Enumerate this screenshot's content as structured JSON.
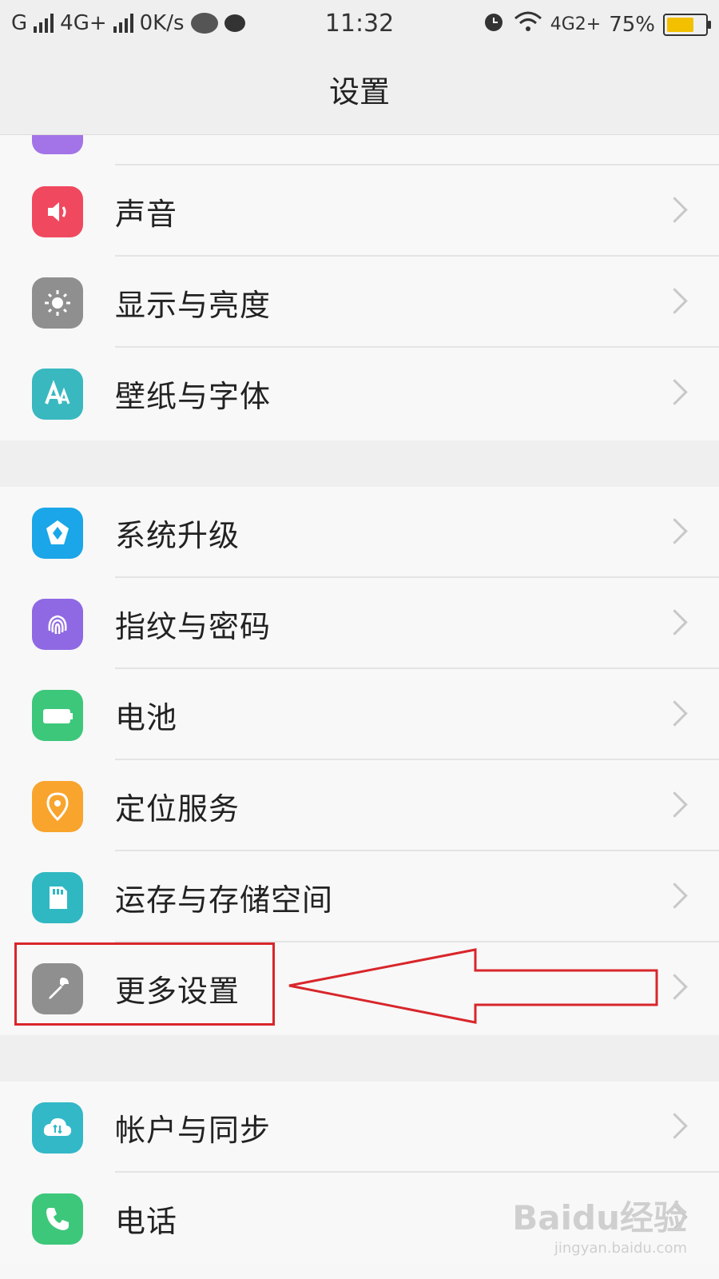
{
  "status_bar": {
    "carrier1": "G",
    "carrier2": "4G+",
    "speed": "0K/s",
    "time": "11:32",
    "network_right": "4G",
    "sim_right": "2+",
    "battery": "75%",
    "battery_level": 0.75,
    "battery_color": "#f3c000"
  },
  "header": {
    "title": "设置"
  },
  "settings": {
    "group1": [
      {
        "label": "声音",
        "icon": "speaker-icon",
        "color": "#f0495f"
      },
      {
        "label": "显示与亮度",
        "icon": "sun-icon",
        "color": "#8f8f8f"
      },
      {
        "label": "壁纸与字体",
        "icon": "font-icon",
        "color": "#39b8c0"
      }
    ],
    "group2": [
      {
        "label": "系统升级",
        "icon": "upgrade-icon",
        "color": "#1aa6e8"
      },
      {
        "label": "指纹与密码",
        "icon": "fingerprint-icon",
        "color": "#8f69e3"
      },
      {
        "label": "电池",
        "icon": "battery-icon",
        "color": "#3dc77a"
      },
      {
        "label": "定位服务",
        "icon": "location-pin-icon",
        "color": "#f9a42d"
      },
      {
        "label": "运存与存储空间",
        "icon": "sd-card-icon",
        "color": "#30b8c2"
      },
      {
        "label": "更多设置",
        "icon": "wrench-icon",
        "color": "#8f8f8f"
      }
    ],
    "group3": [
      {
        "label": "帐户与同步",
        "icon": "cloud-sync-icon",
        "color": "#33b8c8"
      },
      {
        "label": "电话",
        "icon": "phone-icon",
        "color": "#3dc77a"
      }
    ]
  },
  "watermark": {
    "brand": "Baidu经验",
    "url": "jingyan.baidu.com"
  }
}
